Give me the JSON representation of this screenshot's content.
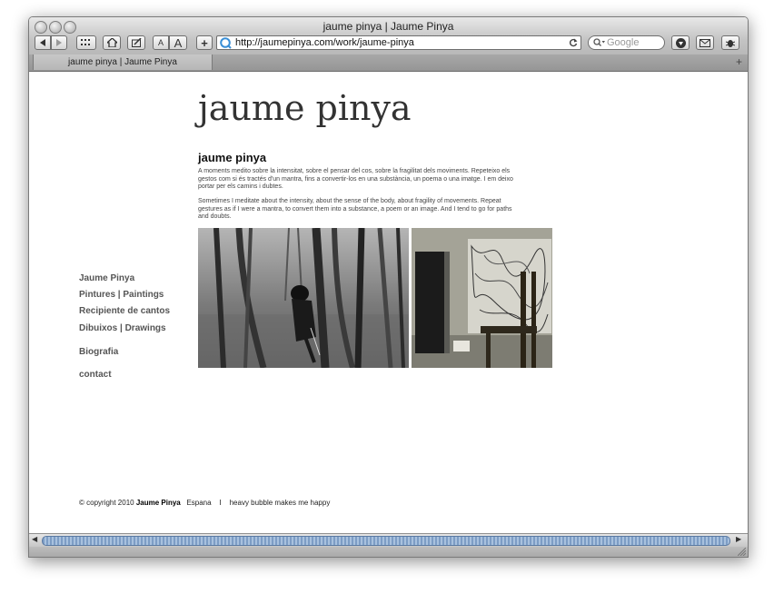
{
  "window": {
    "title": "jaume pinya | Jaume Pinya"
  },
  "toolbar": {
    "url": "http://jaumepinya.com/work/jaume-pinya",
    "search_placeholder": "Google",
    "font_small": "A",
    "font_large": "A",
    "add": "+"
  },
  "tab": {
    "label": "jaume pinya | Jaume Pinya",
    "new_tab": "+"
  },
  "page": {
    "site_title": "jaume pinya",
    "heading": "jaume pinya",
    "paragraph_ca": "A moments medito sobre la intensitat, sobre el pensar del cos, sobre la fragilitat dels moviments. Repeteixo els gestos com si és tractés d'un mantra, fins a convertir-los en una substància, un poema o una imatge. I em deixo portar per els camins i dubtes.",
    "paragraph_en": "Sometimes I meditate about the intensity, about the sense of the body, about fragility of movements. Repeat gestures as if I were a mantra, to convert them into a substance, a poem or an image. And I tend to go for paths and doubts."
  },
  "nav": {
    "items": [
      {
        "label": "Jaume Pinya"
      },
      {
        "label": "Pintures | Paintings"
      },
      {
        "label": "Recipiente de cantos"
      },
      {
        "label": "Dibuixos | Drawings"
      },
      {
        "label": "Biografia"
      },
      {
        "label": "contact"
      }
    ]
  },
  "footer": {
    "copyright": "© copyright 2010",
    "name": "Jaume Pinya",
    "country": "Espana",
    "separator": "I",
    "tagline": "heavy bubble makes me happy"
  }
}
